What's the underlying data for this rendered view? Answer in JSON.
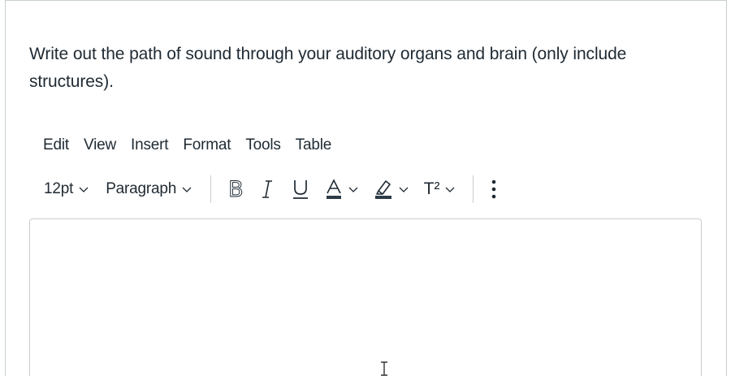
{
  "question": {
    "text": "Write out the path of sound through your auditory organs and brain (only include structures)."
  },
  "menubar": {
    "items": [
      "Edit",
      "View",
      "Insert",
      "Format",
      "Tools",
      "Table"
    ]
  },
  "toolbar": {
    "font_size": "12pt",
    "block_format": "Paragraph",
    "bold_label": "B",
    "superscript_label": "T²",
    "icons": [
      "bold-icon",
      "italic-icon",
      "underline-icon",
      "text-color-icon",
      "highlight-icon",
      "superscript-icon",
      "more-options-icon"
    ]
  },
  "editor": {
    "value": ""
  },
  "colors": {
    "text": "#1f2a33",
    "border": "#c7cdd1",
    "accent_underline": "#2d3b45"
  }
}
